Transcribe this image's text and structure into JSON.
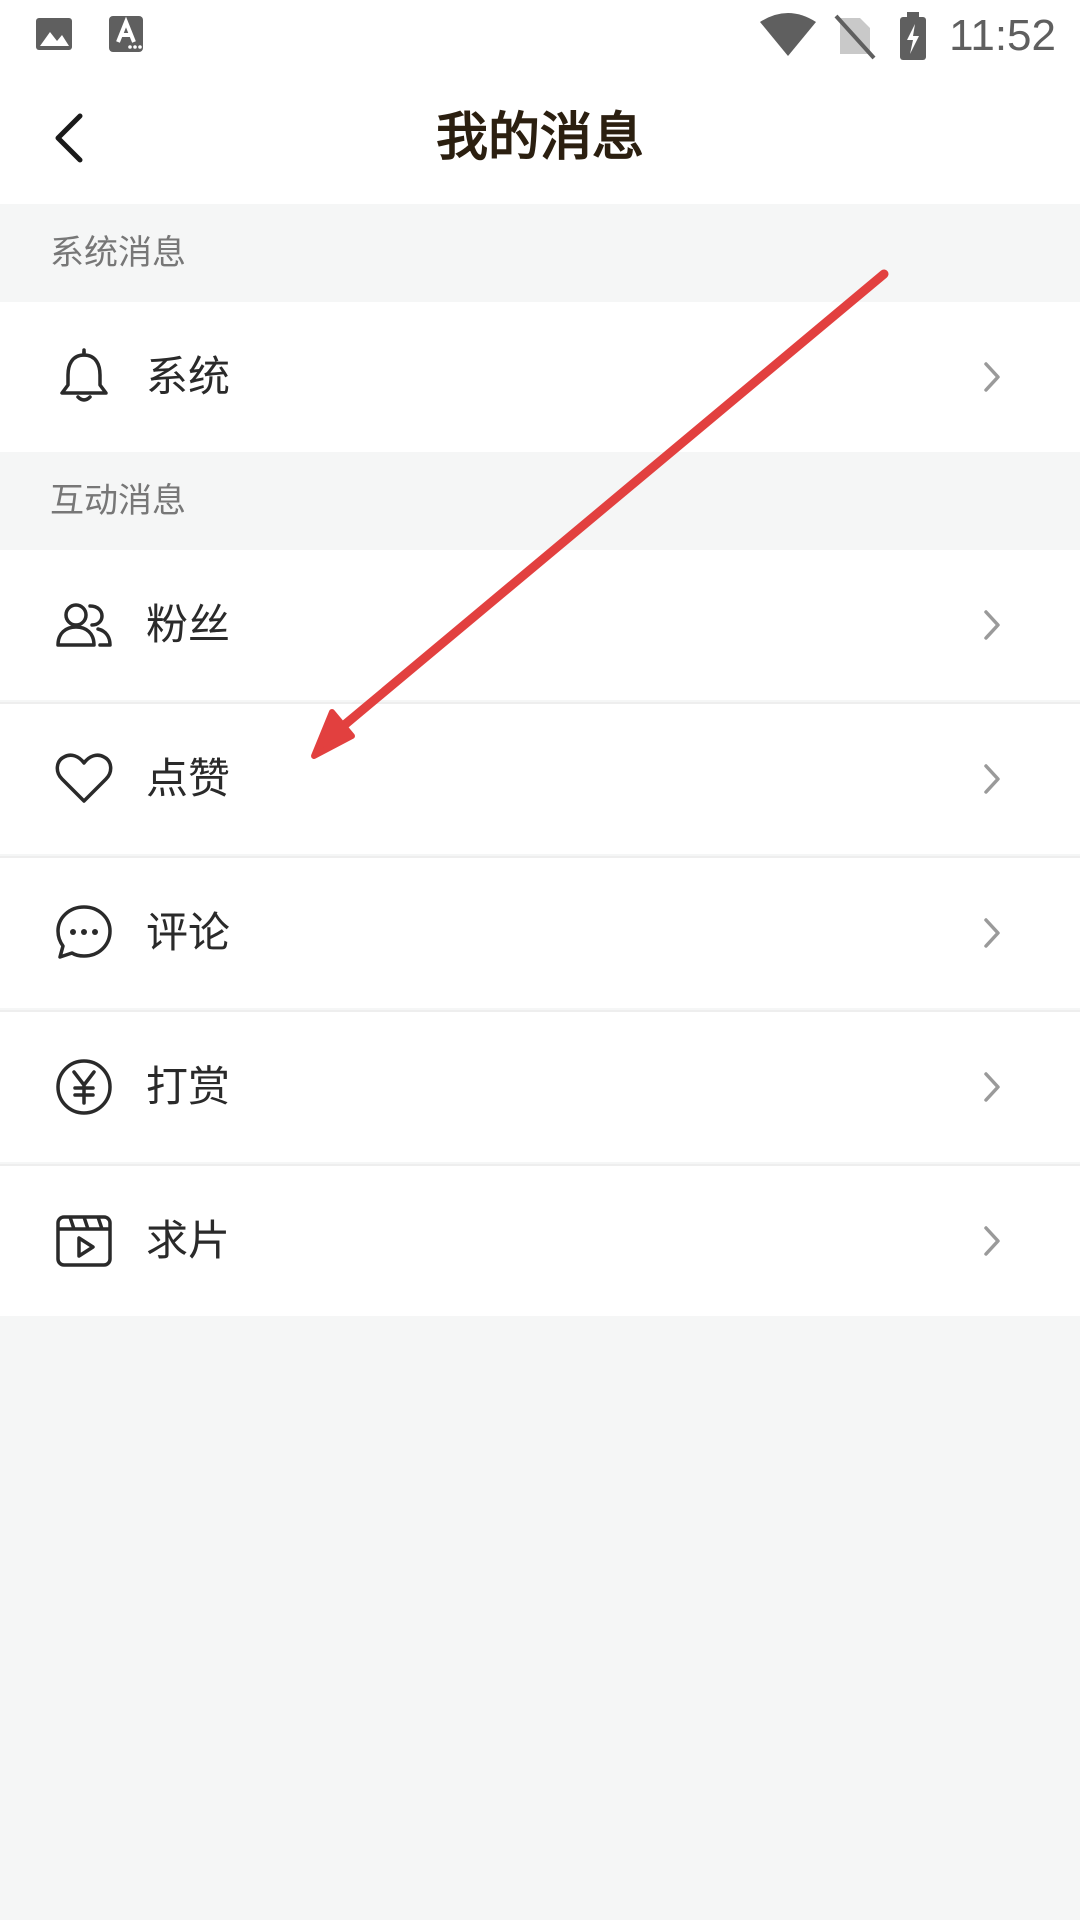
{
  "status_bar": {
    "time": "11:52",
    "icons": [
      "gallery-icon",
      "text-a-icon",
      "wifi-icon",
      "no-sim-icon",
      "battery-charging-icon"
    ]
  },
  "header": {
    "title": "我的消息",
    "back_icon": "chevron-left-icon"
  },
  "sections": {
    "system": {
      "label": "系统消息",
      "items": [
        {
          "label": "系统",
          "icon": "bell-icon"
        }
      ]
    },
    "interaction": {
      "label": "互动消息",
      "items": [
        {
          "label": "粉丝",
          "icon": "fans-icon"
        },
        {
          "label": "点赞",
          "icon": "heart-icon"
        },
        {
          "label": "评论",
          "icon": "comment-icon"
        },
        {
          "label": "打赏",
          "icon": "yen-coin-icon"
        },
        {
          "label": "求片",
          "icon": "video-request-icon"
        }
      ]
    }
  },
  "annotation": {
    "arrow_color": "#e2403f"
  },
  "colors": {
    "background": "#f5f6f6",
    "row_background": "#ffffff",
    "title": "#2b1f10",
    "section_label": "#777777",
    "row_label": "#2a2a2a",
    "chevron": "#9a9a9a"
  }
}
